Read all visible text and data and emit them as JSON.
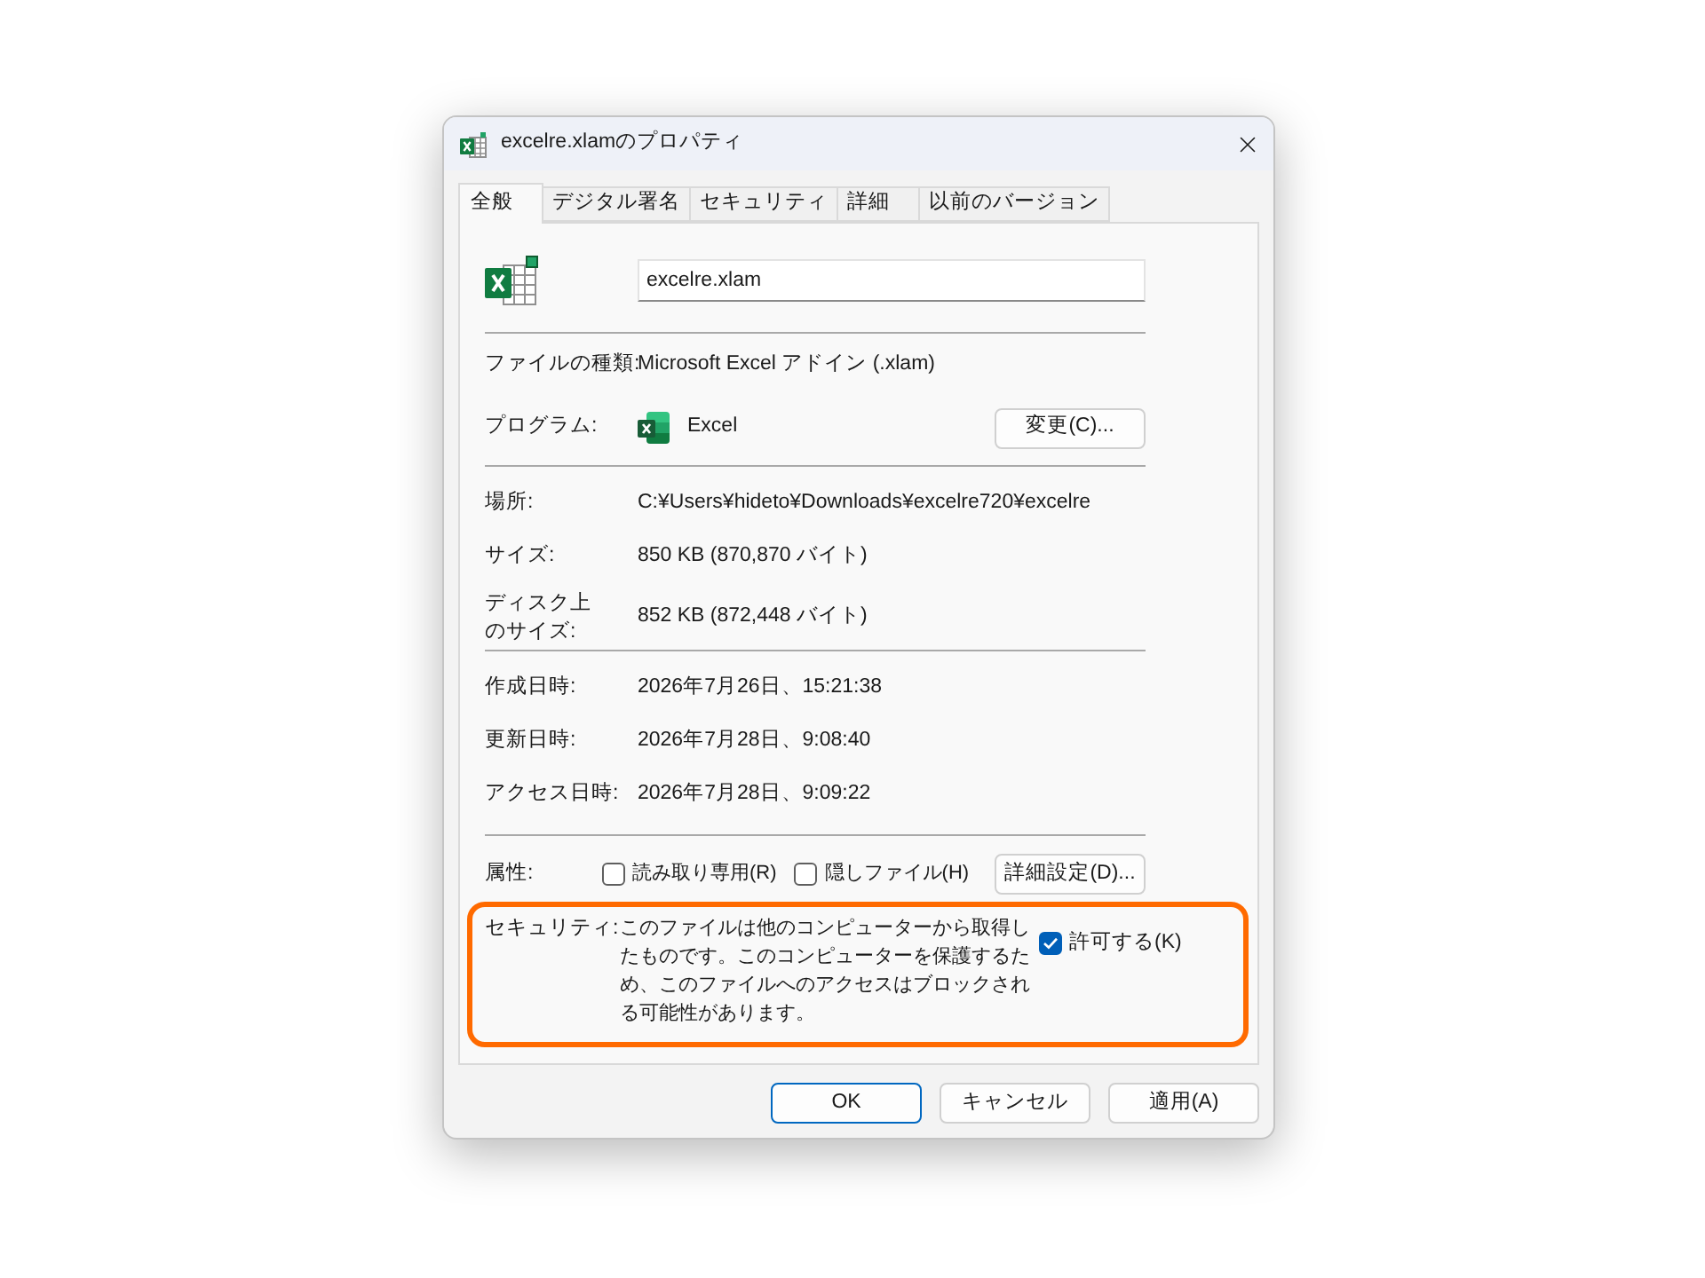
{
  "window": {
    "title": "excelre.xlamのプロパティ"
  },
  "tabs": [
    {
      "label": "全般",
      "selected": true
    },
    {
      "label": "デジタル署名",
      "selected": false
    },
    {
      "label": "セキュリティ",
      "selected": false
    },
    {
      "label": "詳細",
      "selected": false
    },
    {
      "label": "以前のバージョン",
      "selected": false
    }
  ],
  "file_name": {
    "value": "excelre.xlam"
  },
  "groups": [
    [
      {
        "kind": "text",
        "label": "ファイルの種類:",
        "value": "Microsoft Excel アドイン (.xlam)"
      },
      {
        "kind": "program",
        "label": "プログラム:",
        "value": "Excel",
        "button": "変更(C)..."
      }
    ],
    [
      {
        "kind": "text",
        "label": "場所:",
        "value": "C:¥Users¥hideto¥Downloads¥excelre720¥excelre"
      },
      {
        "kind": "text",
        "label": "サイズ:",
        "value": "850 KB (870,870 バイト)"
      },
      {
        "kind": "wrapped",
        "label": "ディスク上のサイズ:",
        "value": "852 KB (872,448 バイト)"
      }
    ],
    [
      {
        "kind": "text",
        "label": "作成日時:",
        "value": "2026年7月26日、15:21:38"
      },
      {
        "kind": "text",
        "label": "更新日時:",
        "value": "2026年7月28日、9:08:40"
      },
      {
        "kind": "text",
        "label": "アクセス日時:",
        "value": "2026年7月28日、9:09:22"
      }
    ]
  ],
  "attributes": {
    "label": "属性:",
    "checkboxes": [
      {
        "label": "読み取り専用(R)",
        "checked": false
      },
      {
        "label": "隠しファイル(H)",
        "checked": false
      }
    ],
    "button": "詳細設定(D)..."
  },
  "security": {
    "highlighted": true,
    "label": "セキュリティ:",
    "message": "このファイルは他のコンピューターから取得したものです。このコンピューターを保護するため、このファイルへのアクセスはブロックされる可能性があります。",
    "checkbox": {
      "label": "許可する(K)",
      "checked": true
    }
  },
  "buttons": [
    {
      "label": "OK",
      "default": true
    },
    {
      "label": "キャンセル",
      "default": false
    },
    {
      "label": "適用(A)",
      "default": false
    }
  ]
}
